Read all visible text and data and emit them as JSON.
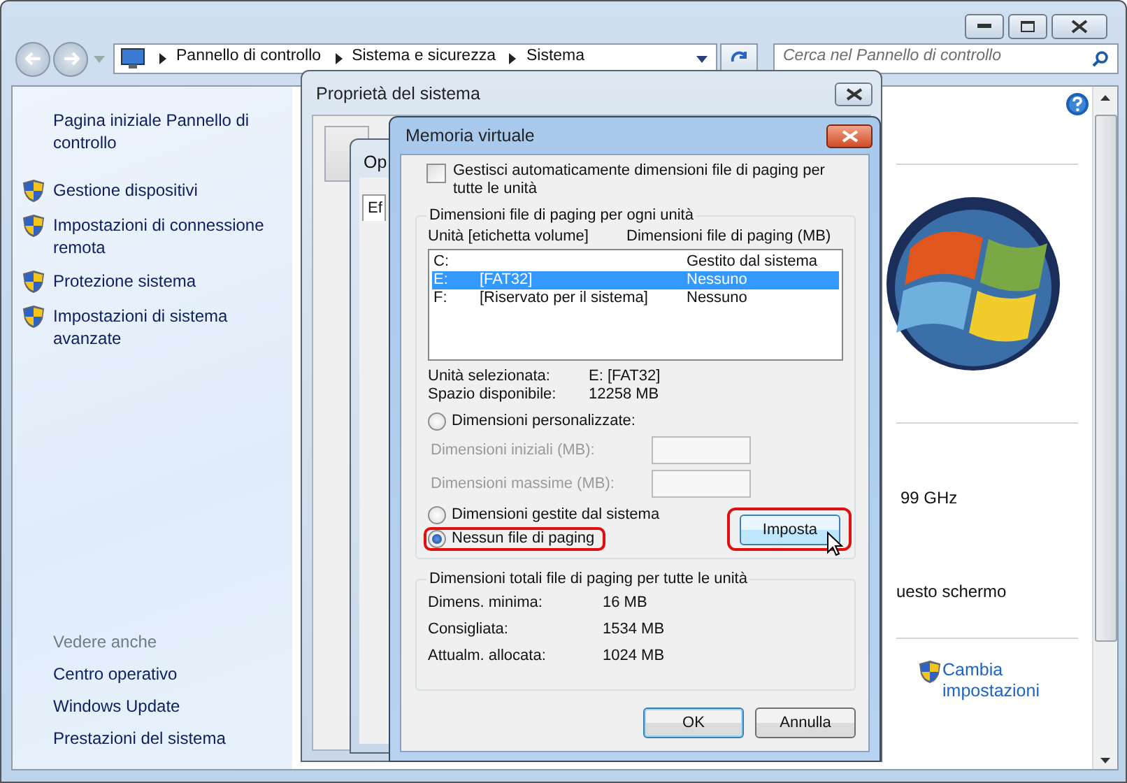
{
  "explorer": {
    "address": {
      "crumbs": [
        "Pannello di controllo",
        "Sistema e sicurezza",
        "Sistema"
      ]
    },
    "search": {
      "placeholder": "Cerca nel Pannello di controllo"
    },
    "sidebar": {
      "home_link": "Pagina iniziale Pannello di controllo",
      "tasks": [
        "Gestione dispositivi",
        "Impostazioni di connessione remota",
        "Protezione sistema",
        "Impostazioni di sistema avanzate"
      ],
      "see_also_heading": "Vedere anche",
      "see_also": [
        "Centro operativo",
        "Windows Update",
        "Prestazioni del sistema"
      ]
    },
    "content": {
      "texts": [
        "99 GHz",
        "uesto schermo"
      ],
      "change_link": "Cambia impostazioni"
    }
  },
  "system_properties": {
    "title": "Proprietà del sistema",
    "background_window_title": "Op",
    "background_tab": "Ef"
  },
  "virtual_memory": {
    "title": "Memoria virtuale",
    "auto_manage": {
      "label": "Gestisci automaticamente dimensioni file di paging per tutte le unità",
      "checked": false
    },
    "drives": {
      "legend": "Dimensioni file di paging per ogni unità",
      "columns": [
        "Unità [etichetta volume]",
        "Dimensioni file di paging (MB)"
      ],
      "list": [
        {
          "drive": "C:",
          "size": "Gestito dal sistema",
          "selected": false
        },
        {
          "drive": "E:",
          "label": "[FAT32]",
          "size": "Nessuno",
          "selected": true
        },
        {
          "drive": "F:",
          "label": "[Riservato per il sistema]",
          "size": "Nessuno",
          "selected": false
        }
      ]
    },
    "info": [
      {
        "label": "Unità selezionata:",
        "value": "E:  [FAT32]"
      },
      {
        "label": "Spazio disponibile:",
        "value": "12258 MB"
      }
    ],
    "size_options": [
      {
        "label": "Dimensioni personalizzate:",
        "selected": false,
        "highlighted": false
      },
      {
        "label": "Dimensioni gestite dal sistema",
        "selected": false,
        "highlighted": false
      },
      {
        "label": "Nessun file di paging",
        "selected": true,
        "highlighted": true
      }
    ],
    "size_fields": [
      {
        "label": "Dimensioni iniziali (MB):",
        "disabled": true
      },
      {
        "label": "Dimensioni massime (MB):",
        "disabled": true
      }
    ],
    "set_button": {
      "label": "Imposta",
      "highlighted": true,
      "hovered": true
    },
    "totals": {
      "legend": "Dimensioni totali file di paging per tutte le unità",
      "rows": [
        {
          "label": "Dimens. minima:",
          "value": "16 MB"
        },
        {
          "label": "Consigliata:",
          "value": "1534 MB"
        },
        {
          "label": "Attualm. allocata:",
          "value": "1024 MB"
        }
      ]
    },
    "buttons": [
      {
        "label": "OK",
        "default": true
      },
      {
        "label": "Annulla",
        "default": false
      }
    ]
  }
}
